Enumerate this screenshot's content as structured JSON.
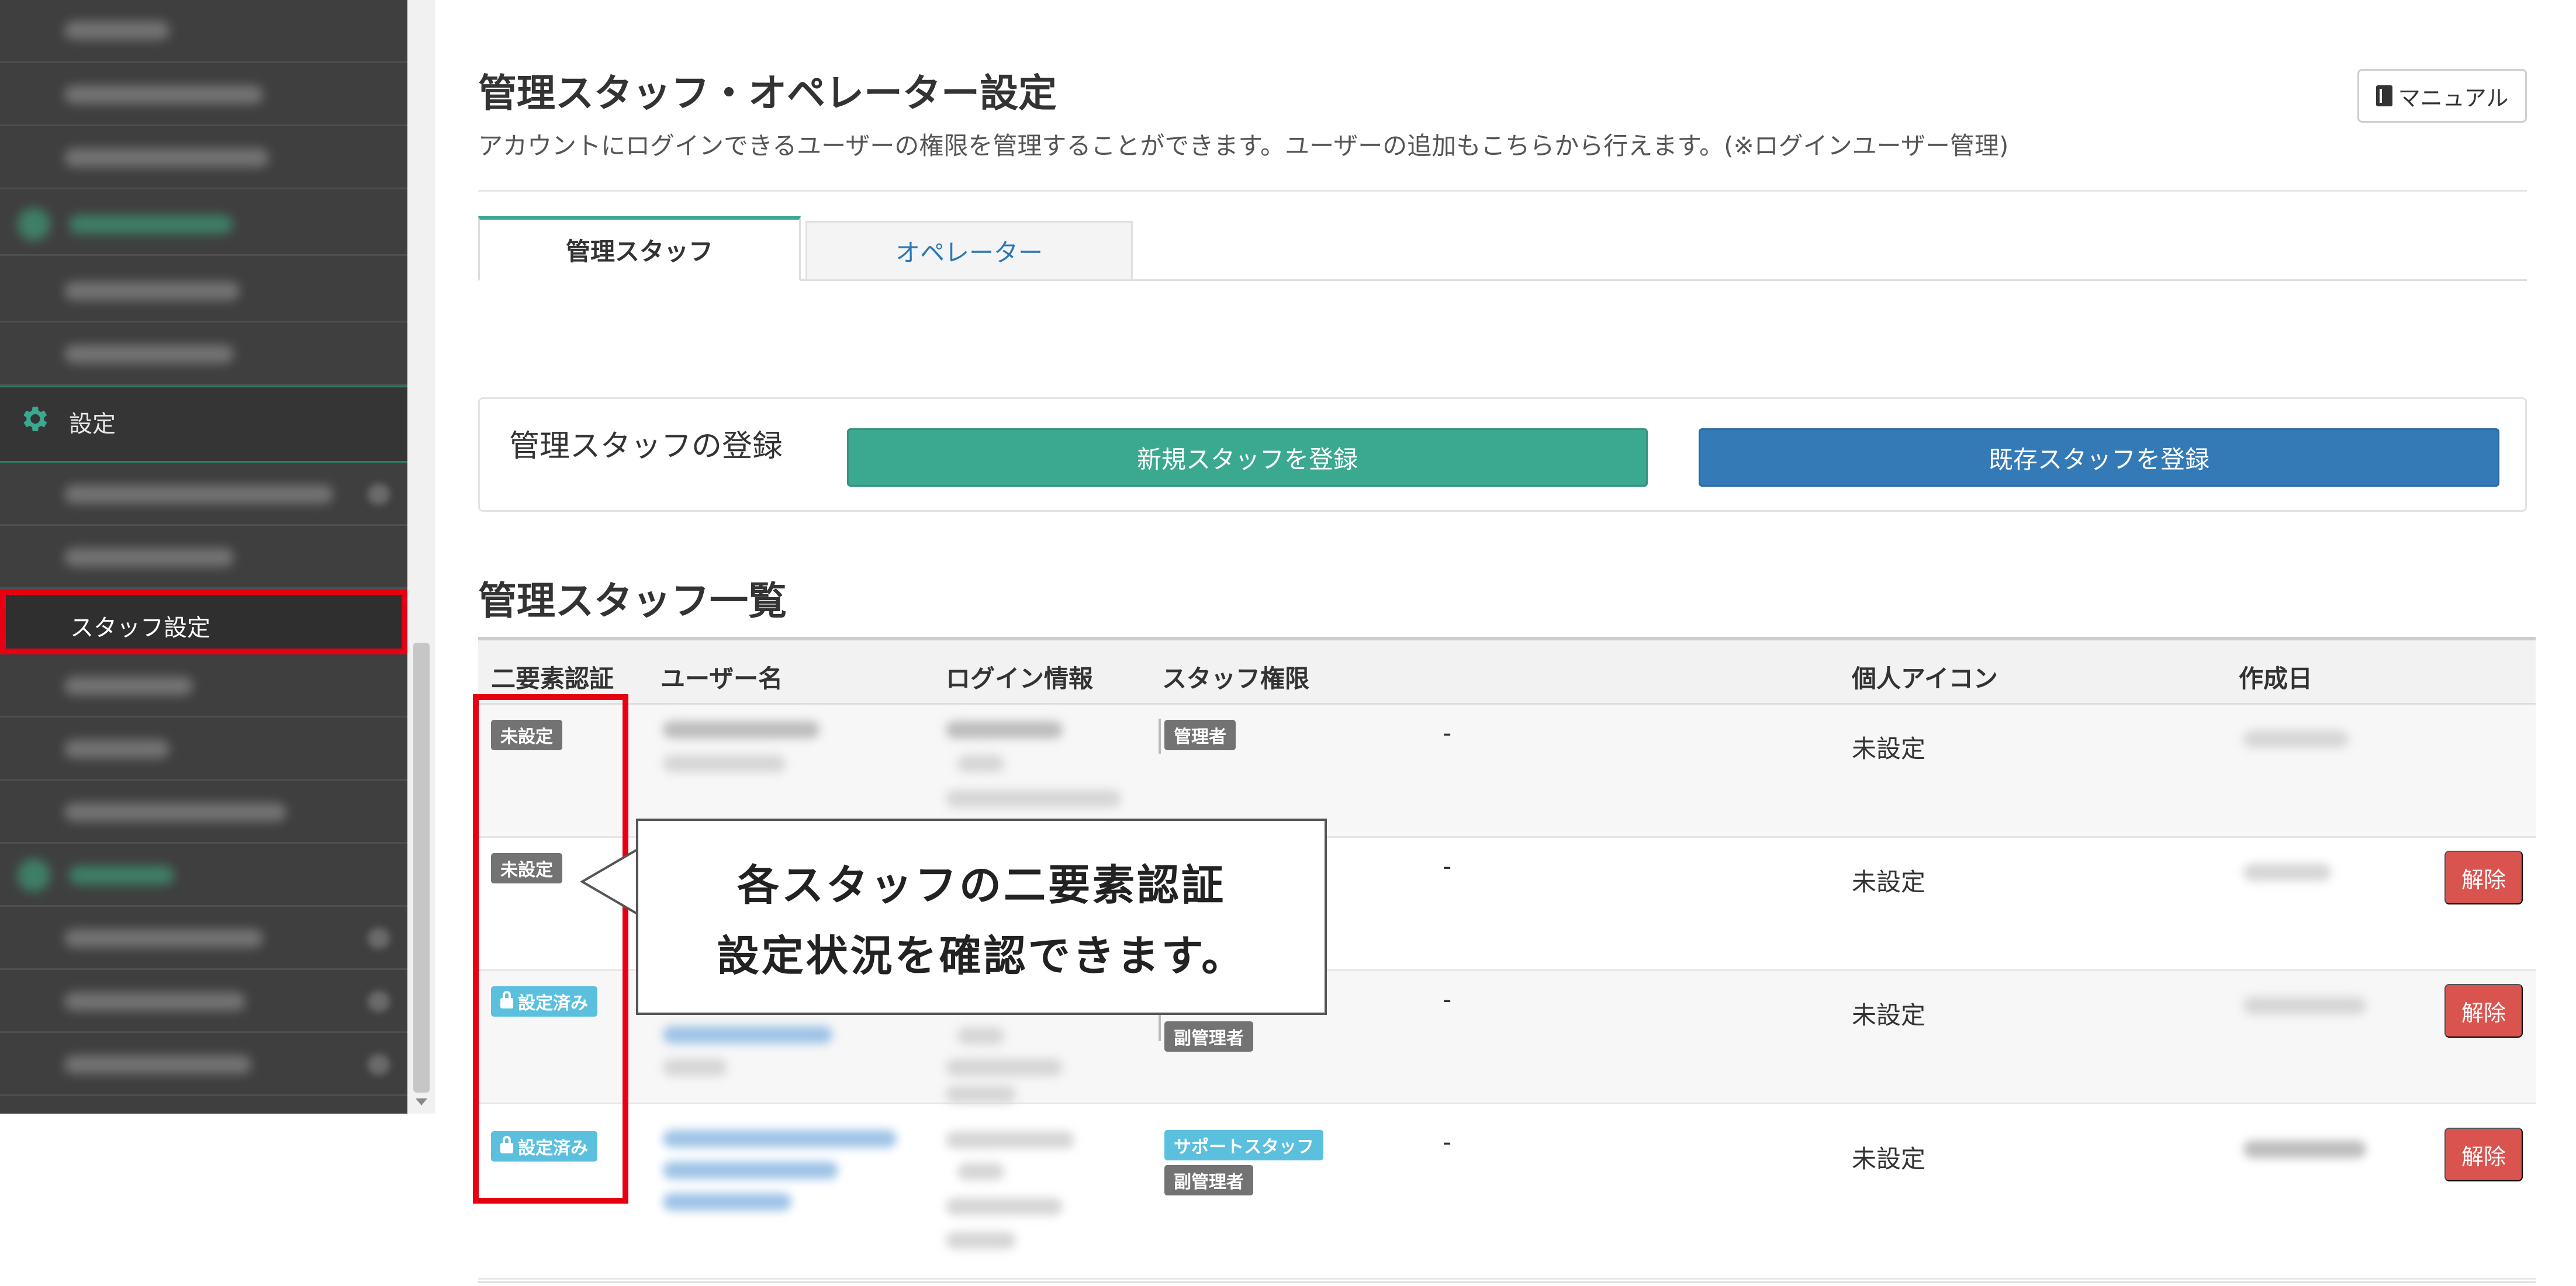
{
  "sidebar": {
    "section_label": "設定",
    "active_item": "スタッフ設定"
  },
  "header": {
    "title": "管理スタッフ・オペレーター設定",
    "description": "アカウントにログインできるユーザーの権限を管理することができます。ユーザーの追加もこちらから行えます。(※ログインユーザー管理)",
    "manual_button": "マニュアル"
  },
  "tabs": [
    {
      "label": "管理スタッフ",
      "active": true
    },
    {
      "label": "オペレーター",
      "active": false
    }
  ],
  "register": {
    "title": "管理スタッフの登録",
    "new_button": "新規スタッフを登録",
    "existing_button": "既存スタッフを登録"
  },
  "list": {
    "title": "管理スタッフ一覧",
    "columns": [
      "二要素認証",
      "ユーザー名",
      "ログイン情報",
      "スタッフ権限",
      "個人アイコン",
      "作成日"
    ],
    "rows": [
      {
        "two_factor": "未設定",
        "roles": [
          "管理者"
        ],
        "dash": "-",
        "icon": "未設定",
        "created": "",
        "action": ""
      },
      {
        "two_factor": "未設定",
        "roles": [],
        "dash": "-",
        "icon": "未設定",
        "created": "",
        "action": "解除"
      },
      {
        "two_factor": "設定済み",
        "roles": [
          "副管理者"
        ],
        "dash": "-",
        "icon": "未設定",
        "created": "",
        "action": "解除"
      },
      {
        "two_factor": "設定済み",
        "roles": [
          "サポートスタッフ",
          "副管理者"
        ],
        "dash": "-",
        "icon": "未設定",
        "created": "",
        "action": "解除"
      }
    ]
  },
  "annotation": {
    "line1": "各スタッフの二要素認証",
    "line2": "設定状況を確認できます。"
  },
  "colors": {
    "accent_green": "#3aa98f",
    "primary_blue": "#337ab7",
    "danger_red": "#d9534f",
    "highlight_red": "#e60012"
  }
}
